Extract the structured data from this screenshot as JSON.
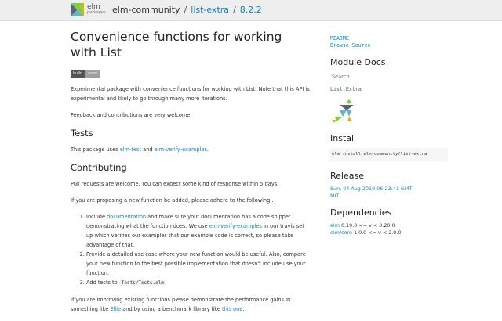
{
  "header": {
    "logo_name": "elm",
    "logo_sub": "packages",
    "author": "elm-community",
    "package": "list-extra",
    "version": "8.2.2"
  },
  "main": {
    "title": "Convenience functions for working with List",
    "badge": {
      "left": "build",
      "right": "error"
    },
    "intro": "Experimental package with convenience functions for working with List. Note that this API is experimental and likely to go through many more iterations.",
    "feedback": "Feedback and contributions are very welcome.",
    "tests_heading": "Tests",
    "tests": {
      "pre": "This package uses ",
      "link1": "elm-test",
      "mid": " and ",
      "link2": "elm-verify-examples",
      "post": "."
    },
    "contrib_heading": "Contributing",
    "pull": "Pull requests are welcome. You can expect some kind of response within 5 days.",
    "proposing": "If you are proposing a new function be added, please adhere to the following..",
    "list": {
      "i1_pre": "Include ",
      "i1_link": "documentation",
      "i1_mid": " and make sure your documentation has a code snippet demonstrating what the function does. We use ",
      "i1_link2": "elm-verify-examples",
      "i1_post": " in our travis set up which verifies our examples that our example code is correct, so please take advantage of that.",
      "i2": "Provide a detailed use case where your new function would be useful. Also, compare your new function to the best possible implementation that doesn't include use your function.",
      "i3_pre": "Add tests to ",
      "i3_code": "Tests/Tests.elm"
    },
    "improving": {
      "pre": "If you are improving existing functions please demonstrate the performance gains in something like ",
      "link1": "Ellie",
      "mid": " and by using a benchmark library like ",
      "link2": "this one",
      "post": "."
    }
  },
  "sidebar": {
    "readme": "README",
    "browse": "Browse Source",
    "module_docs": "Module Docs",
    "search_placeholder": "Search",
    "module": "List.Extra",
    "install": "Install",
    "install_cmd": "elm install elm-community/list-extra",
    "release": "Release",
    "release_date": "Sun, 04 Aug 2019 06:23:41 GMT",
    "license": "MIT",
    "deps": "Dependencies",
    "dep1": {
      "name": "elm",
      "range": " 0.19.0 <= v < 0.20.0"
    },
    "dep2": {
      "name": "elm/core",
      "range": " 1.0.0 <= v < 2.0.0"
    }
  }
}
